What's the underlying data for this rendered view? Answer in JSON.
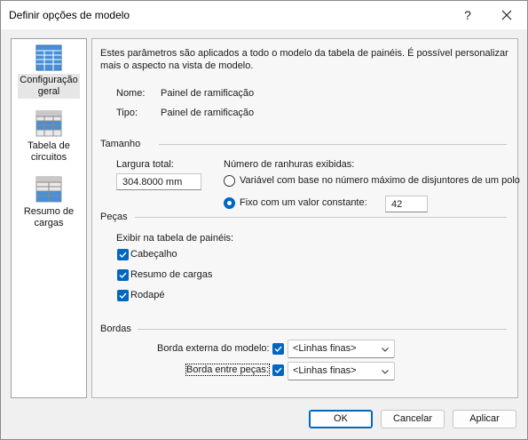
{
  "window": {
    "title": "Definir opções de modelo",
    "help_glyph": "?",
    "close_icon": "close-icon"
  },
  "nav": {
    "items": [
      {
        "label_line1": "Configuração",
        "label_line2": "geral",
        "icon": "settings-grid-icon",
        "selected": true
      },
      {
        "label_line1": "Tabela de",
        "label_line2": "circuitos",
        "icon": "circuit-table-icon",
        "selected": false
      },
      {
        "label_line1": "Resumo de",
        "label_line2": "cargas",
        "icon": "load-summary-icon",
        "selected": false
      }
    ]
  },
  "general": {
    "description": "Estes parâmetros são aplicados a todo o modelo da tabela de painéis. É possível personalizar mais o aspecto na vista de modelo.",
    "name_label": "Nome:",
    "name_value": "Painel de ramificação",
    "type_label": "Tipo:",
    "type_value": "Painel de ramificação"
  },
  "size": {
    "section_title": "Tamanho",
    "width_label": "Largura total:",
    "width_value": "304.8000 mm",
    "slots_label": "Número de ranhuras exibidas:",
    "option_variable": "Variável com base no número máximo de disjuntores de um polo",
    "option_fixed": "Fixo com um valor constante:",
    "fixed_value": "42",
    "selected_option": "fixed"
  },
  "parts": {
    "section_title": "Peças",
    "show_label": "Exibir na tabela de painéis:",
    "header_label": "Cabeçalho",
    "header_checked": true,
    "loads_label": "Resumo de cargas",
    "loads_checked": true,
    "footer_label": "Rodapé",
    "footer_checked": true
  },
  "borders": {
    "section_title": "Bordas",
    "outer_label": "Borda externa do modelo:",
    "outer_checked": true,
    "outer_value": "<Linhas finas>",
    "inner_label": "Borda entre peças:",
    "inner_checked": true,
    "inner_value": "<Linhas finas>"
  },
  "buttons": {
    "ok": "OK",
    "cancel": "Cancelar",
    "apply": "Aplicar"
  },
  "colors": {
    "accent": "#0067c0",
    "icon_blue": "#4a8fd6",
    "panel_bg": "#f7f7f7",
    "dialog_bg": "#f0f0f0"
  }
}
